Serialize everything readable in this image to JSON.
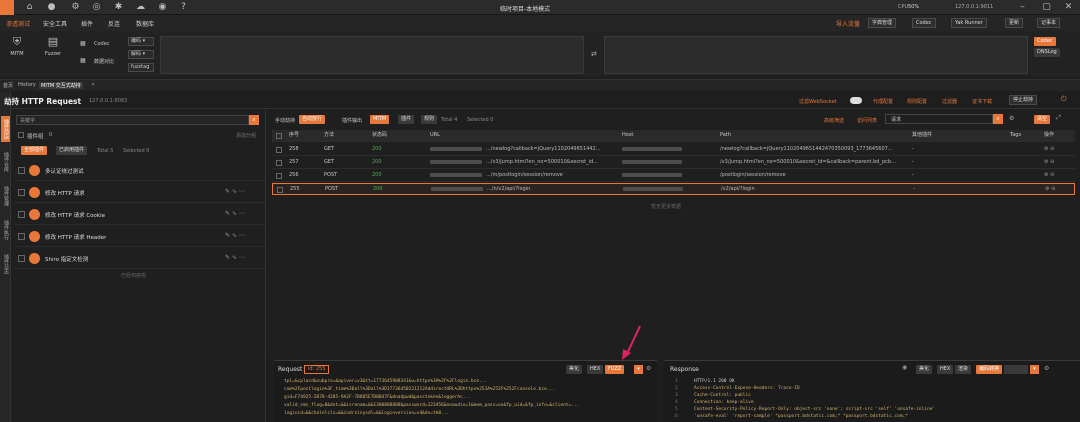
{
  "window": {
    "title": "临时项目-本地模式",
    "status_text": "50%",
    "cpu_text": "12700",
    "port_text": "127.0.0.1:9011"
  },
  "menu": {
    "items": [
      "渗透测试",
      "安全工具",
      "插件",
      "反连",
      "数据库"
    ],
    "right": [
      "导入流量",
      "字典管理",
      "Codec",
      "Yak Runner",
      "更新",
      "记事本"
    ]
  },
  "toolbar": {
    "tools": [
      {
        "label": "MITM",
        "icon": "mitm-icon"
      },
      {
        "label": "Fuzzer",
        "icon": "fuzzer-icon"
      },
      {
        "label": "Codec",
        "icon": "codec-icon"
      },
      {
        "label": "数据对比",
        "icon": "compare-icon"
      }
    ],
    "selects": [
      "编码",
      "解码",
      "fuzztag"
    ],
    "side": [
      "Codec",
      "DNSLog"
    ]
  },
  "tabs": [
    "首页",
    "History",
    "MITM 交互式劫持"
  ],
  "sidebar": [
    "插件商店",
    "插件仓库",
    "插件管理",
    "插件执行",
    "插件日志"
  ],
  "header": {
    "title": "劫持 HTTP Request",
    "address": "127.0.0.1:8083",
    "websocket_label": "过滤WebSocket",
    "links": [
      "代理配置",
      "规则配置",
      "过滤器",
      "证书下载"
    ],
    "stop_button": "停止劫持"
  },
  "left_panel": {
    "search_placeholder": "关键字",
    "plugin_group": "插件组",
    "count": "0",
    "added_label": "添加分组",
    "tabs": [
      "全部插件",
      "已启用插件"
    ],
    "total": "Total 5",
    "selected": "Selected 0",
    "plugins": [
      {
        "name": "多认证绕过测试"
      },
      {
        "name": "修改 HTTP 请求"
      },
      {
        "name": "修改 HTTP 请求 Cookie"
      },
      {
        "name": "修改 HTTP 请求 Header"
      },
      {
        "name": "Shiro 指定文检测"
      }
    ],
    "footer": "已经到底啦"
  },
  "right_panel": {
    "modes": [
      "手动劫持",
      "自动放行",
      "插件输出"
    ],
    "buttons": [
      "MITM",
      "插件",
      "规则"
    ],
    "total": "Total 4",
    "selected": "Selected 0",
    "links": [
      "高级筛选",
      "访问列表",
      "请求"
    ],
    "clear": "清空",
    "columns": [
      "序号",
      "方法",
      "状态码",
      "URL",
      "Host",
      "Path",
      "其他插件",
      "Tags",
      "操作"
    ],
    "rows": [
      {
        "id": "258",
        "method": "GET",
        "status": "200",
        "url": ".../newlog?callback=jQuery1102049651442...",
        "path": "/newlog?callback=jQuery1102049651442470350093_1773645607...",
        "tag": "-"
      },
      {
        "id": "257",
        "method": "GET",
        "status": "200",
        "url": ".../v3/jump.html?en_no=500010&secret_id...",
        "path": "/v3/jump.html?en_no=500010&secret_id=&callback=parent.bd_pcb...",
        "tag": "-"
      },
      {
        "id": "256",
        "method": "POST",
        "status": "200",
        "url": ".../m/postlogin/session/remove",
        "path": "/postlogin/session/remove",
        "tag": "-"
      },
      {
        "id": "255",
        "method": "POST",
        "status": "200",
        "url": ".../n/v2/api/?login",
        "path": "/v2/api/?login",
        "tag": "-"
      }
    ],
    "footer": "暂无更多数据"
  },
  "request": {
    "title": "Request",
    "id_label": "id: 255",
    "buttons": [
      "美化",
      "HEX",
      "FUZZ"
    ],
    "lines": [
      "tpl=&cplacd&subpro=&apiver=v3&tt=1773645908341&u=https%3A%2F%2Flogin.bce...",
      "com%2Fpostlogin%3F_time%3Dall%3Dall%3D17736450221212AddirectURL%3Dhttps%253A%252F%252Fconsole.bce...",
      "gid=F74925-2B78-4285-9A2F-7B8D5E7D0B47F&dnadpwd&passtoken&loggerAc...",
      "valid_sms_flag=0&dnt=&&isrenam=&&1308888888&password=123456&noaudio=1&mem_pass=on&fp_uid=&fp_info=&client=...",
      "loginid=&&chalnlcls=&&indrzinysdl=&&loginversion=v4&dv=tk0..."
    ]
  },
  "response": {
    "title": "Response",
    "buttons": [
      "美化",
      "HEX",
      "渲染",
      "编码转换"
    ],
    "lines": [
      "HTTP/1.1 200 OK",
      "Access-Control-Expose-Headers: Trace-ID",
      "Cache-Control: public",
      "Connection: keep-alive",
      "Content-Security-Policy-Report-Only: object-src 'none'; script-src 'self' 'unsafe-inline'",
      "'unsafe-eval' 'report-sample' *passport.bdstatic.com;* *passport.bdstatic.com;*"
    ],
    "line_numbers": [
      "1",
      "2",
      "3",
      "4",
      "5",
      "6"
    ]
  },
  "colors": {
    "accent": "#e8773a",
    "background": "#1e1e1e",
    "status_ok": "#4caf50",
    "code_key": "#d6b36b"
  }
}
